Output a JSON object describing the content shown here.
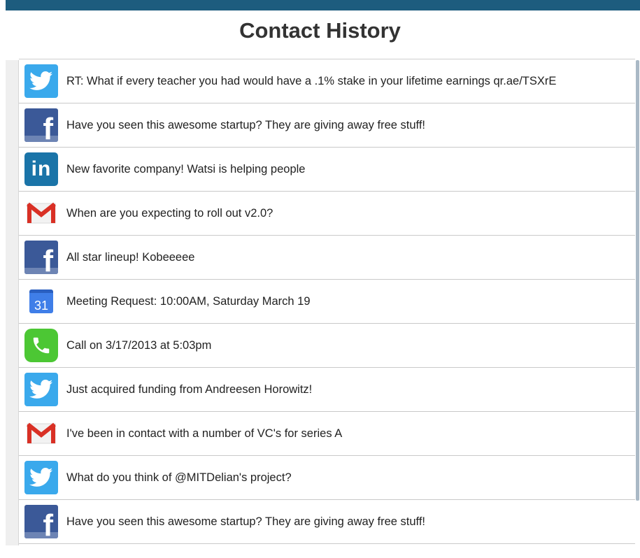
{
  "page": {
    "title": "Contact History"
  },
  "colors": {
    "topbar": "#1d5c7e",
    "twitter": "#3aa9ec",
    "facebook": "#3b5998",
    "linkedin": "#1a74a8",
    "phone": "#4cc734",
    "calendar": "#3f7ee8",
    "gmail_red": "#d93025"
  },
  "icons": {
    "calendar_day": "31",
    "linkedin_text": "in",
    "facebook_text": "f"
  },
  "history": [
    {
      "icon": "twitter-icon",
      "text": "RT: What if every teacher you had would have a .1% stake in your lifetime earnings qr.ae/TSXrE"
    },
    {
      "icon": "facebook-icon",
      "text": "Have you seen this awesome startup? They are giving away free stuff!"
    },
    {
      "icon": "linkedin-icon",
      "text": "New favorite company! Watsi is helping people"
    },
    {
      "icon": "gmail-icon",
      "text": "When are you expecting to roll out v2.0?"
    },
    {
      "icon": "facebook-icon",
      "text": "All star lineup! Kobeeeee"
    },
    {
      "icon": "calendar-icon",
      "text": "Meeting Request: 10:00AM, Saturday March 19"
    },
    {
      "icon": "phone-icon",
      "text": "Call on 3/17/2013 at 5:03pm"
    },
    {
      "icon": "twitter-icon",
      "text": "Just acquired funding from Andreesen Horowitz!"
    },
    {
      "icon": "gmail-icon",
      "text": "I've been in contact with a number of VC's for series A"
    },
    {
      "icon": "twitter-icon",
      "text": "What do you think of @MITDelian's project?"
    },
    {
      "icon": "facebook-icon",
      "text": "Have you seen this awesome startup? They are giving away free stuff!"
    }
  ]
}
